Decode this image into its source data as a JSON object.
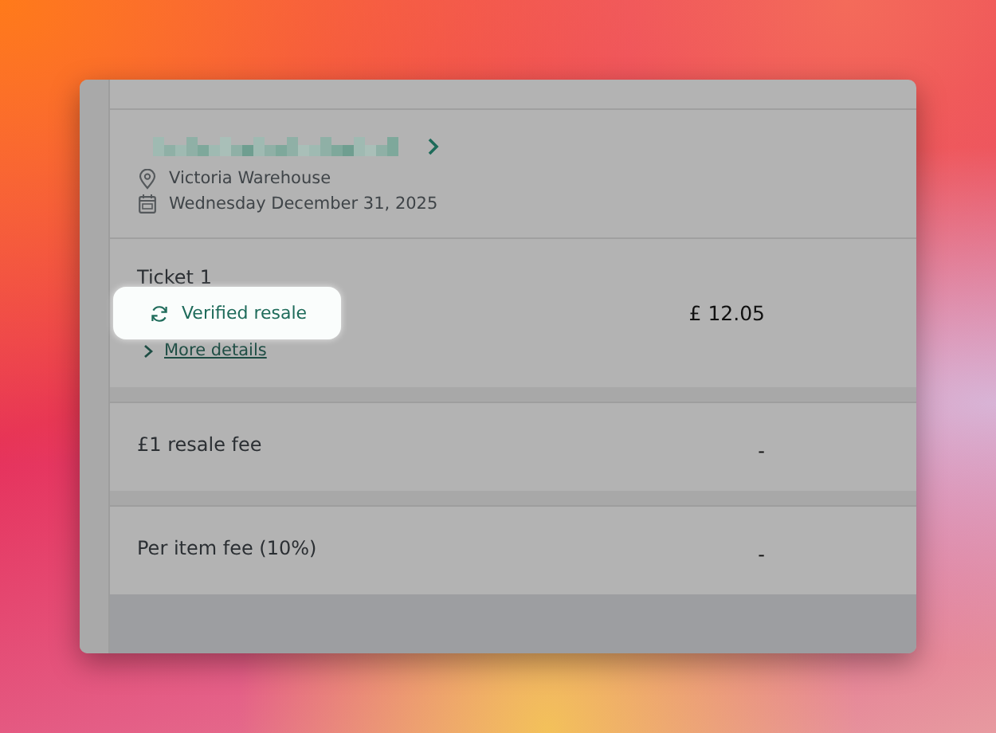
{
  "event": {
    "venue": "Victoria Warehouse",
    "date": "Wednesday December 31, 2025"
  },
  "ticket": {
    "label": "Ticket 1",
    "badge": "Verified resale",
    "link": "More details",
    "price": "£ 12.05"
  },
  "fees": [
    {
      "label": "£1 resale fee",
      "amount": "-"
    },
    {
      "label": "Per item fee (10%)",
      "amount": "-"
    }
  ]
}
